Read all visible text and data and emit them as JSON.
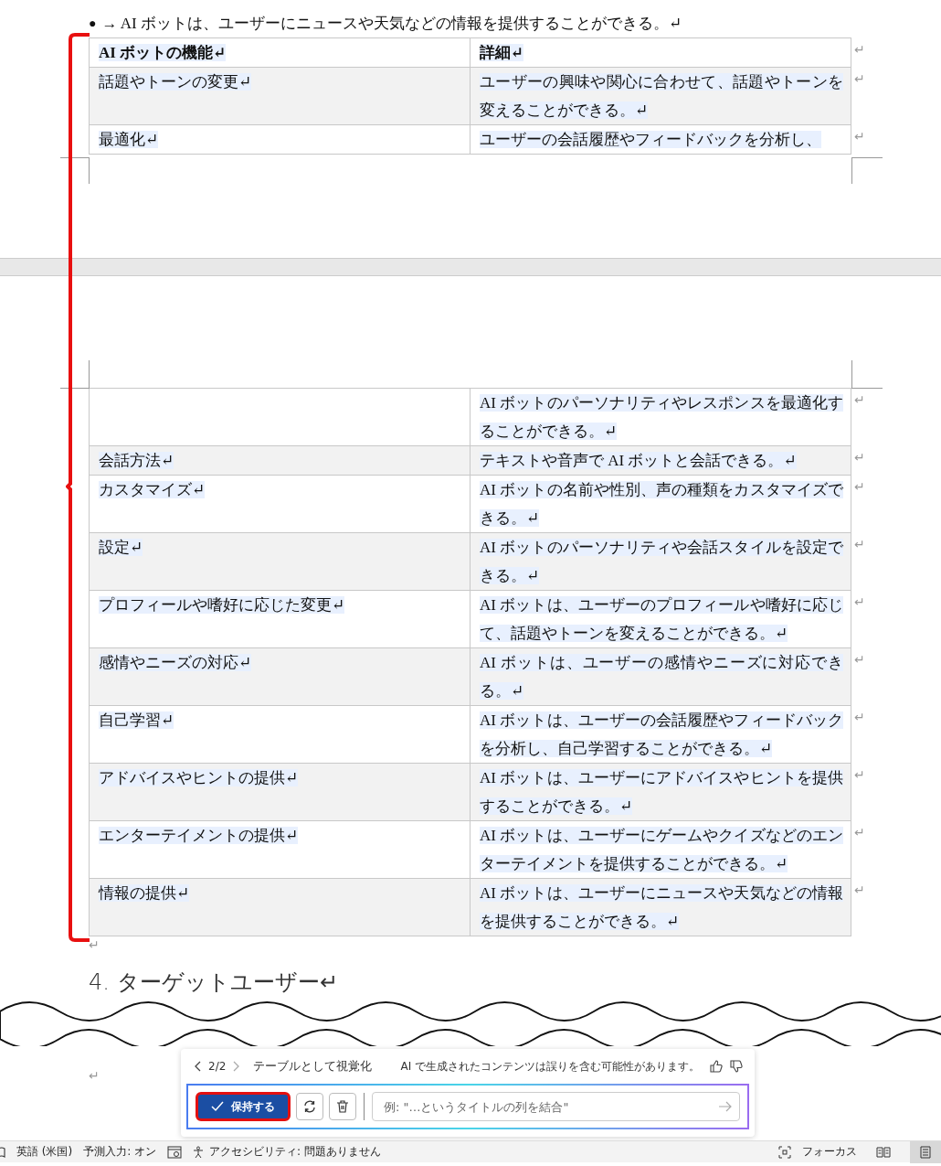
{
  "top_bullet": {
    "bullet": "●",
    "text": "→ AI ボットは、ユーザーにニュースや天気などの情報を提供することができる。↵"
  },
  "table": {
    "header": {
      "feature": "AI ボットの機能↵",
      "detail": "詳細↵",
      "end_mark": "↵"
    },
    "rows_page1": [
      {
        "feature": "話題やトーンの変更↵",
        "detail": "ユーザーの興味や関心に合わせて、話題やトーンを変えることができる。↵",
        "shaded": true,
        "end_mark": "↵"
      },
      {
        "feature": "最適化↵",
        "detail": "ユーザーの会話履歴やフィードバックを分析し、",
        "shaded": false,
        "end_mark": "↵"
      }
    ],
    "rows_page2": [
      {
        "detail": "AI ボットのパーソナリティやレスポンスを最適化することができる。↵",
        "shaded": false,
        "end_mark": "↵"
      },
      {
        "feature": "会話方法↵",
        "detail": "テキストや音声で AI ボットと会話できる。↵",
        "shaded": true,
        "end_mark": "↵"
      },
      {
        "feature": "カスタマイズ↵",
        "detail": "AI ボットの名前や性別、声の種類をカスタマイズできる。↵",
        "shaded": false,
        "end_mark": "↵"
      },
      {
        "feature": "設定↵",
        "detail": "AI ボットのパーソナリティや会話スタイルを設定できる。↵",
        "shaded": true,
        "end_mark": "↵"
      },
      {
        "feature": "プロフィールや嗜好に応じた変更↵",
        "detail": "AI ボットは、ユーザーのプロフィールや嗜好に応じて、話題やトーンを変えることができる。↵",
        "shaded": false,
        "end_mark": "↵"
      },
      {
        "feature": "感情やニーズの対応↵",
        "detail": "AI ボットは、ユーザーの感情やニーズに対応できる。↵",
        "shaded": true,
        "end_mark": "↵"
      },
      {
        "feature": "自己学習↵",
        "detail": "AI ボットは、ユーザーの会話履歴やフィードバックを分析し、自己学習することができる。↵",
        "shaded": false,
        "end_mark": "↵"
      },
      {
        "feature": "アドバイスやヒントの提供↵",
        "detail": "AI ボットは、ユーザーにアドバイスやヒントを提供することができる。↵",
        "shaded": true,
        "end_mark": "↵"
      },
      {
        "feature": "エンターテイメントの提供↵",
        "detail": "AI ボットは、ユーザーにゲームやクイズなどのエンターテイメントを提供することができる。↵",
        "shaded": false,
        "end_mark": "↵"
      },
      {
        "feature": "情報の提供↵",
        "detail": "AI ボットは、ユーザーにニュースや天気などの情報を提供することができる。↵",
        "shaded": true,
        "end_mark": "↵"
      }
    ]
  },
  "after_table_mark": "↵",
  "heading": "4. ターゲットユーザー↵",
  "trailing_mark": "↵",
  "copilot": {
    "page": "2/2",
    "title": "テーブルとして視覚化",
    "disclaimer": "AI で生成されたコンテンツは誤りを含む可能性があります。",
    "keep_button": "保持する",
    "placeholder": "例: \"…というタイトルの列を結合\""
  },
  "status_bar": {
    "language": "英語 (米国)",
    "prediction": "予測入力: オン",
    "accessibility": "アクセシビリティ: 問題ありません",
    "focus": "フォーカス",
    "views": [
      {
        "kind": "read",
        "selected": false
      },
      {
        "kind": "print",
        "selected": true
      }
    ]
  }
}
